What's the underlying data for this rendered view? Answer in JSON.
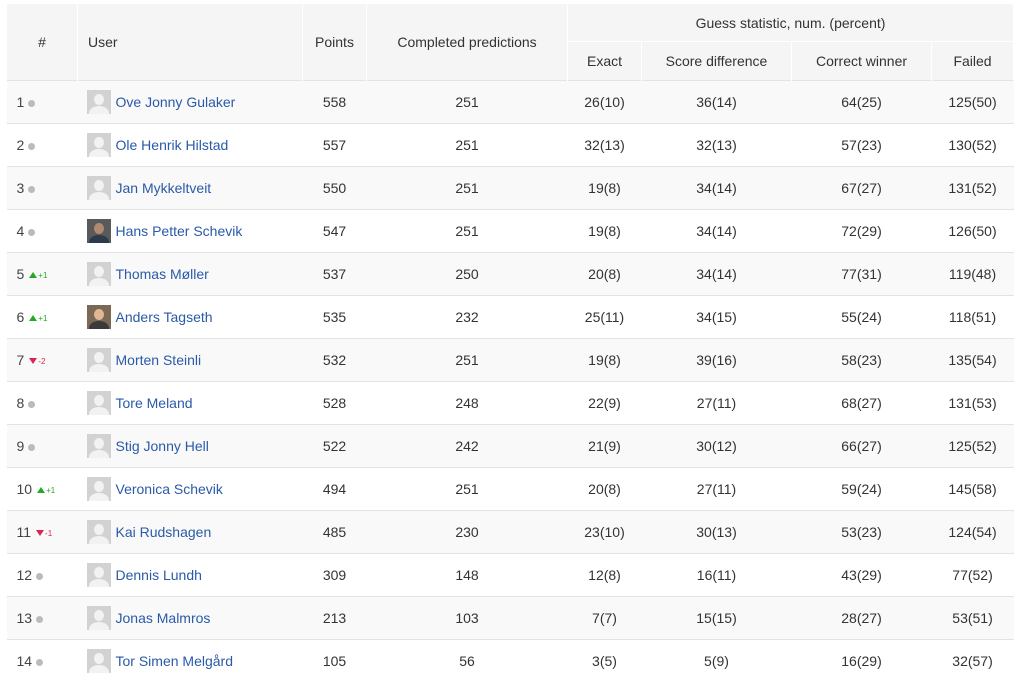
{
  "header": {
    "rank": "#",
    "user": "User",
    "points": "Points",
    "completed": "Completed predictions",
    "guess_group": "Guess statistic, num. (percent)",
    "exact": "Exact",
    "score_difference": "Score difference",
    "correct_winner": "Correct winner",
    "failed": "Failed"
  },
  "colors": {
    "link": "#2a5aa8",
    "up": "#22aa22",
    "down": "#dd2255",
    "neutral_dot": "#bbbbbb"
  },
  "rows": [
    {
      "rank": "1",
      "trend": "same",
      "delta": "",
      "avatar": "default",
      "name": "Ove Jonny Gulaker",
      "points": "558",
      "completed": "251",
      "exact": "26(10)",
      "diff": "36(14)",
      "winner": "64(25)",
      "failed": "125(50)"
    },
    {
      "rank": "2",
      "trend": "same",
      "delta": "",
      "avatar": "default",
      "name": "Ole Henrik Hilstad",
      "points": "557",
      "completed": "251",
      "exact": "32(13)",
      "diff": "32(13)",
      "winner": "57(23)",
      "failed": "130(52)"
    },
    {
      "rank": "3",
      "trend": "same",
      "delta": "",
      "avatar": "default",
      "name": "Jan Mykkeltveit",
      "points": "550",
      "completed": "251",
      "exact": "19(8)",
      "diff": "34(14)",
      "winner": "67(27)",
      "failed": "131(52)"
    },
    {
      "rank": "4",
      "trend": "same",
      "delta": "",
      "avatar": "photo1",
      "name": "Hans Petter Schevik",
      "points": "547",
      "completed": "251",
      "exact": "19(8)",
      "diff": "34(14)",
      "winner": "72(29)",
      "failed": "126(50)"
    },
    {
      "rank": "5",
      "trend": "up",
      "delta": "+1",
      "avatar": "default",
      "name": "Thomas Møller",
      "points": "537",
      "completed": "250",
      "exact": "20(8)",
      "diff": "34(14)",
      "winner": "77(31)",
      "failed": "119(48)"
    },
    {
      "rank": "6",
      "trend": "up",
      "delta": "+1",
      "avatar": "photo2",
      "name": "Anders Tagseth",
      "points": "535",
      "completed": "232",
      "exact": "25(11)",
      "diff": "34(15)",
      "winner": "55(24)",
      "failed": "118(51)"
    },
    {
      "rank": "7",
      "trend": "down",
      "delta": "-2",
      "avatar": "default",
      "name": "Morten Steinli",
      "points": "532",
      "completed": "251",
      "exact": "19(8)",
      "diff": "39(16)",
      "winner": "58(23)",
      "failed": "135(54)"
    },
    {
      "rank": "8",
      "trend": "same",
      "delta": "",
      "avatar": "default",
      "name": "Tore Meland",
      "points": "528",
      "completed": "248",
      "exact": "22(9)",
      "diff": "27(11)",
      "winner": "68(27)",
      "failed": "131(53)"
    },
    {
      "rank": "9",
      "trend": "same",
      "delta": "",
      "avatar": "default",
      "name": "Stig Jonny Hell",
      "points": "522",
      "completed": "242",
      "exact": "21(9)",
      "diff": "30(12)",
      "winner": "66(27)",
      "failed": "125(52)"
    },
    {
      "rank": "10",
      "trend": "up",
      "delta": "+1",
      "avatar": "default",
      "name": "Veronica Schevik",
      "points": "494",
      "completed": "251",
      "exact": "20(8)",
      "diff": "27(11)",
      "winner": "59(24)",
      "failed": "145(58)"
    },
    {
      "rank": "11",
      "trend": "down",
      "delta": "-1",
      "avatar": "default",
      "name": "Kai Rudshagen",
      "points": "485",
      "completed": "230",
      "exact": "23(10)",
      "diff": "30(13)",
      "winner": "53(23)",
      "failed": "124(54)"
    },
    {
      "rank": "12",
      "trend": "same",
      "delta": "",
      "avatar": "default",
      "name": "Dennis Lundh",
      "points": "309",
      "completed": "148",
      "exact": "12(8)",
      "diff": "16(11)",
      "winner": "43(29)",
      "failed": "77(52)"
    },
    {
      "rank": "13",
      "trend": "same",
      "delta": "",
      "avatar": "default",
      "name": "Jonas Malmros",
      "points": "213",
      "completed": "103",
      "exact": "7(7)",
      "diff": "15(15)",
      "winner": "28(27)",
      "failed": "53(51)"
    },
    {
      "rank": "14",
      "trend": "same",
      "delta": "",
      "avatar": "default",
      "name": "Tor Simen Melgård",
      "points": "105",
      "completed": "56",
      "exact": "3(5)",
      "diff": "5(9)",
      "winner": "16(29)",
      "failed": "32(57)"
    }
  ]
}
